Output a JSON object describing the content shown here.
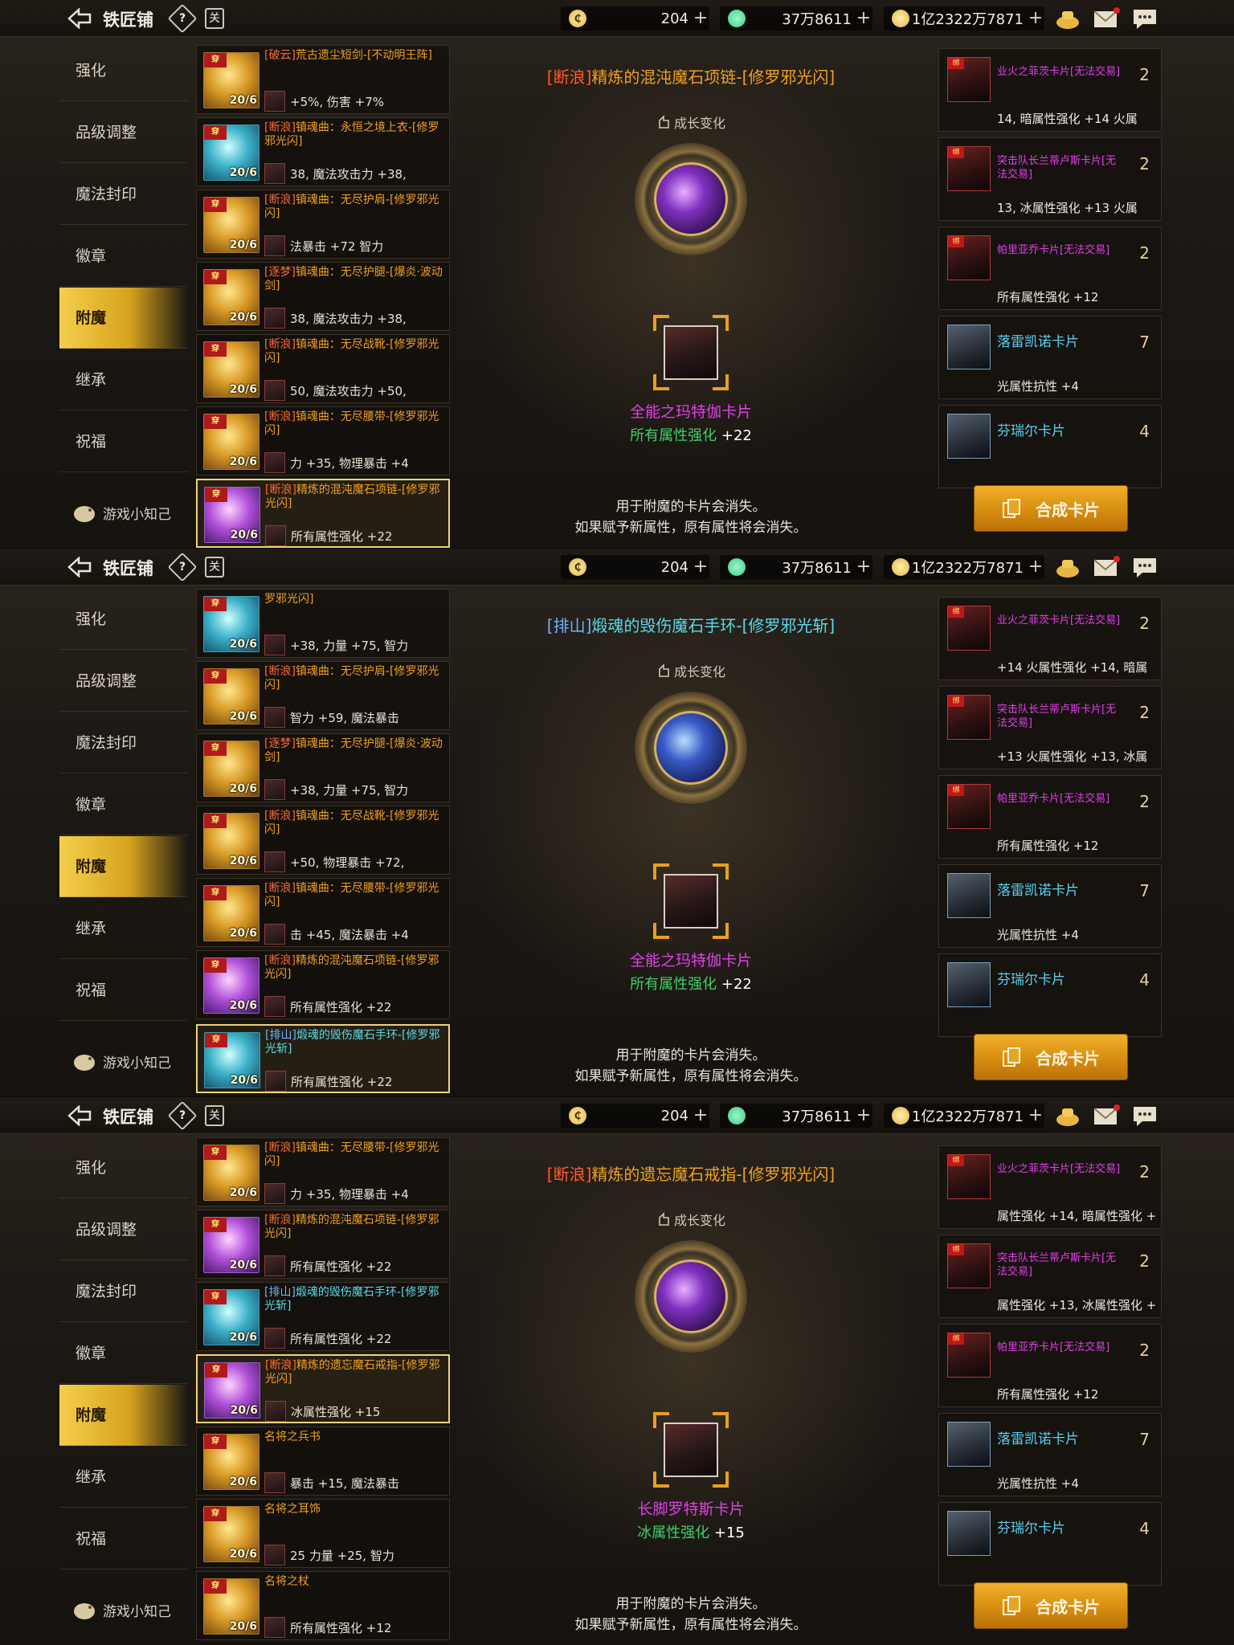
{
  "header": {
    "title": "铁匠铺",
    "help_label": "?",
    "book_label": "关",
    "currencies": [
      {
        "value": "204",
        "icon": "c-coin-icon",
        "color": "#e3b34a"
      },
      {
        "value": "37万8611",
        "icon": "green-gem-icon",
        "color": "#3ad08a"
      },
      {
        "value": "1亿2322万7871",
        "icon": "gold-coin-icon",
        "color": "#e3b34a"
      }
    ],
    "plus": "+"
  },
  "nav": {
    "items": [
      "强化",
      "品级调整",
      "魔法封印",
      "徽章",
      "附魔",
      "继承",
      "祝福"
    ],
    "active_index": 4,
    "tips_label": "游戏小知己"
  },
  "cards_panel": {
    "rows": [
      {
        "name": "业火之菲茨卡片[无法交易]",
        "count": "2",
        "locked": true
      },
      {
        "name": "突击队长兰蒂卢斯卡片[无法交易]",
        "count": "2",
        "locked": true
      },
      {
        "name": "帕里亚乔卡片[无法交易]",
        "count": "2",
        "locked": true,
        "stat": "所有属性强化 +12"
      },
      {
        "name": "落雷凯诺卡片",
        "count": "7",
        "locked": false,
        "stat": "光属性抗性 +4"
      },
      {
        "name": "芬瑞尔卡片",
        "count": "4",
        "locked": false
      }
    ],
    "synth_button": "合成卡片"
  },
  "notes": [
    "用于附魔的卡片会消失。",
    "如果赋予新属性，原有属性将会消失。"
  ],
  "growth_label": "成长变化",
  "panels": [
    {
      "title_tag": "[断浪]",
      "title_text": "精炼的混沌魔石项链-[修罗邪光闪]",
      "title_color": "orange",
      "orb": "purple",
      "card_name": "全能之玛特伽卡片",
      "card_stat_label": "所有属性强化 ",
      "card_stat_value": "+22",
      "card_row_stats": [
        "14, 暗属性强化 +14    火属",
        "13, 冰属性强化 +13    火属"
      ],
      "items": [
        {
          "tag": "[破云]",
          "name": "荒古遗尘短剑-[不动明王阵]",
          "stat": "+5%, 伤害 +7%",
          "level": "20/6",
          "color": "orange",
          "thumb": "gold"
        },
        {
          "tag": "[断浪]",
          "name": "镇魂曲：永恒之境上衣-[修罗邪光闪]",
          "stat": "38, 魔法攻击力 +38,",
          "level": "20/6",
          "color": "orange",
          "thumb": "blue"
        },
        {
          "tag": "[断浪]",
          "name": "镇魂曲：无尽护肩-[修罗邪光闪]",
          "stat": "法暴击 +72     智力",
          "level": "20/6",
          "color": "orange",
          "thumb": "gold"
        },
        {
          "tag": "[逐梦]",
          "name": "镇魂曲：无尽护腿-[爆炎·波动剑]",
          "stat": "38, 魔法攻击力 +38,",
          "level": "20/6",
          "color": "orange",
          "thumb": "gold"
        },
        {
          "tag": "[断浪]",
          "name": "镇魂曲：无尽战靴-[修罗邪光闪]",
          "stat": "50, 魔法攻击力 +50,",
          "level": "20/6",
          "color": "orange",
          "thumb": "gold"
        },
        {
          "tag": "[断浪]",
          "name": "镇魂曲：无尽腰带-[修罗邪光闪]",
          "stat": "力 +35, 物理暴击 +4",
          "level": "20/6",
          "color": "orange",
          "thumb": "gold"
        },
        {
          "tag": "[断浪]",
          "name": "精炼的混沌魔石项链-[修罗邪光闪]",
          "stat": "所有属性强化 +22",
          "level": "20/6",
          "color": "orange",
          "thumb": "purple",
          "selected": true
        }
      ]
    },
    {
      "title_tag": "[排山]",
      "title_text": "煅魂的毁伤魔石手环-[修罗邪光斩]",
      "title_color": "cyan",
      "orb": "blue",
      "card_name": "全能之玛特伽卡片",
      "card_stat_label": "所有属性强化 ",
      "card_stat_value": "+22",
      "card_row_stats": [
        "+14     火属性强化 +14, 暗属",
        "+13     火属性强化 +13, 冰属"
      ],
      "items": [
        {
          "tag": "",
          "name": "罗邪光闪]",
          "stat": "+38, 力量 +75, 智力",
          "level": "20/6",
          "color": "orange",
          "thumb": "blue"
        },
        {
          "tag": "[断浪]",
          "name": "镇魂曲：无尽护肩-[修罗邪光闪]",
          "stat": "智力 +59, 魔法暴击",
          "level": "20/6",
          "color": "orange",
          "thumb": "gold"
        },
        {
          "tag": "[逐梦]",
          "name": "镇魂曲：无尽护腿-[爆炎·波动剑]",
          "stat": "+38, 力量 +75, 智力",
          "level": "20/6",
          "color": "orange",
          "thumb": "gold"
        },
        {
          "tag": "[断浪]",
          "name": "镇魂曲：无尽战靴-[修罗邪光闪]",
          "stat": "+50, 物理暴击 +72,",
          "level": "20/6",
          "color": "orange",
          "thumb": "gold"
        },
        {
          "tag": "[断浪]",
          "name": "镇魂曲：无尽腰带-[修罗邪光闪]",
          "stat": "击 +45, 魔法暴击 +4",
          "level": "20/6",
          "color": "orange",
          "thumb": "gold"
        },
        {
          "tag": "[断浪]",
          "name": "精炼的混沌魔石项链-[修罗邪光闪]",
          "stat": "所有属性强化 +22",
          "level": "20/6",
          "color": "orange",
          "thumb": "purple"
        },
        {
          "tag": "[排山]",
          "name": "煅魂的毁伤魔石手环-[修罗邪光斩]",
          "stat": "所有属性强化 +22",
          "level": "20/6",
          "color": "cyan",
          "thumb": "blue",
          "selected": true
        }
      ]
    },
    {
      "title_tag": "[断浪]",
      "title_text": "精炼的遗忘魔石戒指-[修罗邪光闪]",
      "title_color": "orange",
      "orb": "purple",
      "card_name": "长脚罗特斯卡片",
      "card_stat_label": "冰属性强化 ",
      "card_stat_value": "+15",
      "card_row_stats": [
        "属性强化 +14, 暗属性强化 +",
        "属性强化 +13, 冰属性强化 +"
      ],
      "items": [
        {
          "tag": "[断浪]",
          "name": "镇魂曲：无尽腰带-[修罗邪光闪]",
          "stat": "力 +35, 物理暴击 +4",
          "level": "20/6",
          "color": "orange",
          "thumb": "gold"
        },
        {
          "tag": "[断浪]",
          "name": "精炼的混沌魔石项链-[修罗邪光闪]",
          "stat": "所有属性强化 +22",
          "level": "20/6",
          "color": "orange",
          "thumb": "purple"
        },
        {
          "tag": "[排山]",
          "name": "煅魂的毁伤魔石手环-[修罗邪光斩]",
          "stat": "所有属性强化 +22",
          "level": "20/6",
          "color": "cyan",
          "thumb": "blue"
        },
        {
          "tag": "[断浪]",
          "name": "精炼的遗忘魔石戒指-[修罗邪光闪]",
          "stat": "冰属性强化 +15",
          "level": "20/6",
          "color": "orange",
          "thumb": "purple",
          "selected": true
        },
        {
          "tag": "",
          "name": "名将之兵书",
          "stat": "暴击 +15, 魔法暴击",
          "level": "20/6",
          "color": "orange",
          "thumb": "gold"
        },
        {
          "tag": "",
          "name": "名将之耳饰",
          "stat": "25     力量 +25, 智力",
          "level": "20/6",
          "color": "orange",
          "thumb": "gold"
        },
        {
          "tag": "",
          "name": "名将之杖",
          "stat": "所有属性强化 +12",
          "level": "20/6",
          "color": "orange",
          "thumb": "gold"
        }
      ]
    }
  ]
}
